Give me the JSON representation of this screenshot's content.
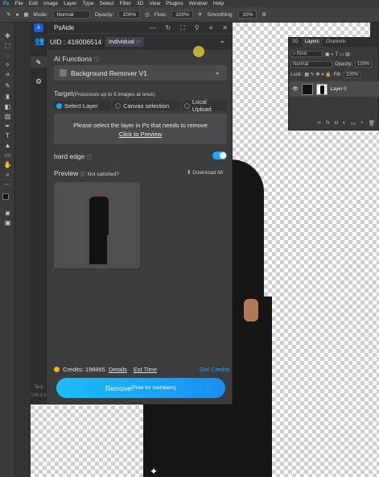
{
  "menubar": {
    "logo": "Ps",
    "items": [
      "File",
      "Edit",
      "Image",
      "Layer",
      "Type",
      "Select",
      "Filter",
      "3D",
      "View",
      "Plugins",
      "Window",
      "Help"
    ]
  },
  "optionsbar": {
    "mode_label": "Mode:",
    "mode_value": "Normal",
    "opacity_label": "Opacity:",
    "opacity_value": "100%",
    "flow_label": "Flow:",
    "flow_value": "100%",
    "smoothing_label": "Smoothing:",
    "smoothing_value": "10%"
  },
  "layers_panel": {
    "tabs": [
      "3D",
      "Layers",
      "Channels"
    ],
    "active_tab": "Layers",
    "filter_value": "Kind",
    "blend_value": "Normal",
    "opacity_label": "Opacity:",
    "opacity_value": "100%",
    "lock_label": "Lock:",
    "fill_label": "Fill:",
    "fill_value": "100%",
    "layer_name": "Layer 0"
  },
  "plugin": {
    "title": "PsAide",
    "uid": "UID : 416006514",
    "account_badge": "Individual",
    "vip_badge": "V7",
    "ai_functions_label": "AI Functions",
    "selected_function": "Background Remover V1",
    "target_label": "Target",
    "target_note": "(Processes up to 5 images at once)",
    "target_options": [
      "Select Layer",
      "Canvas selection",
      "Local Upload"
    ],
    "active_target": "Select Layer",
    "hint_text": "Please select the layer in Ps that needs to remove",
    "hint_link": "Click to Preview",
    "hard_edge_label": "hard edge",
    "hard_edge_on": true,
    "preview_label": "Preview",
    "not_satisfied": "Not satisfied?",
    "download_all": "Download All",
    "credits_label": "Credits: 198865",
    "details_link": "Details",
    "est_time_link": "Est Time",
    "get_credits": "Get Credits",
    "remove_button": "Remove",
    "remove_note": "(Free for members)",
    "version_top": "Test",
    "version": "V25.2.0"
  },
  "colors": {
    "accent": "#1fa5ff",
    "button_gradient_start": "#1ebcf7",
    "button_gradient_end": "#1a8ff2",
    "credit_dot": "#f5b800"
  }
}
